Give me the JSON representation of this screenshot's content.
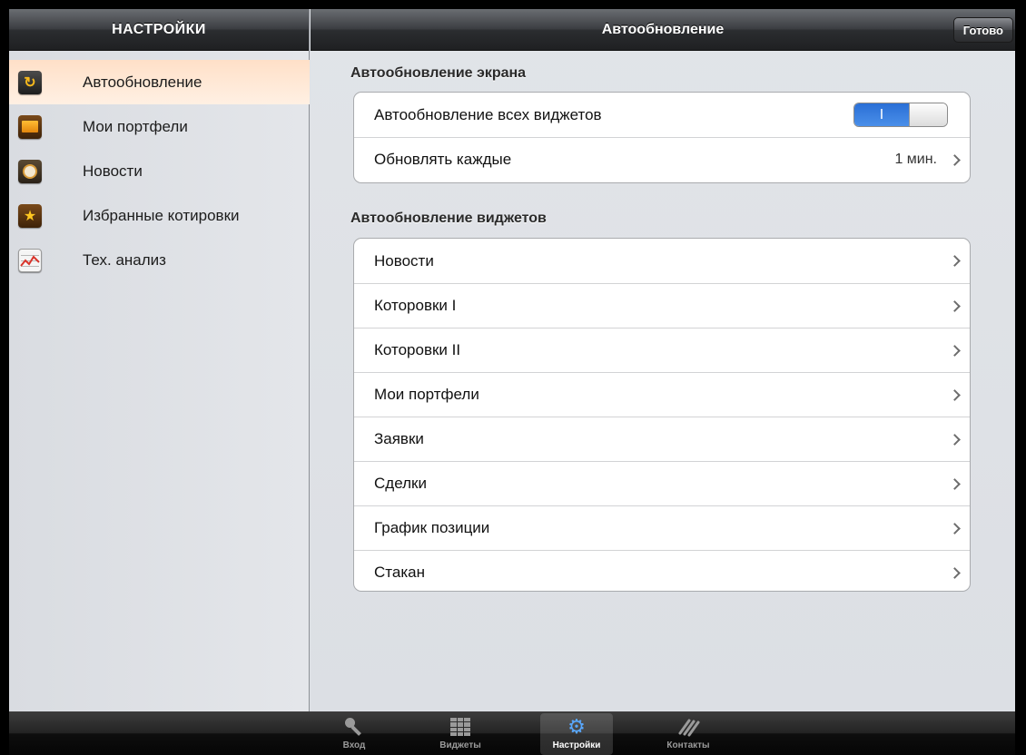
{
  "sidebar": {
    "title": "НАСТРОЙКИ",
    "items": [
      {
        "label": "Автообновление",
        "icon": "refresh-icon",
        "selected": true
      },
      {
        "label": "Мои портфели",
        "icon": "envelope-icon",
        "selected": false
      },
      {
        "label": "Новости",
        "icon": "clock-icon",
        "selected": false
      },
      {
        "label": "Избранные котировки",
        "icon": "star-icon",
        "selected": false
      },
      {
        "label": "Тех. анализ",
        "icon": "chart-icon",
        "selected": false
      }
    ]
  },
  "header": {
    "title": "Автообновление",
    "done_label": "Готово"
  },
  "screen_section": {
    "title": "Автообновление экрана",
    "toggle_row": {
      "label": "Автообновление всех виджетов",
      "toggle_on_text": "I",
      "toggle_state": "on"
    },
    "interval_row": {
      "label": "Обновлять каждые",
      "value": "1 мин."
    }
  },
  "widgets_section": {
    "title": "Автообновление виджетов",
    "rows": [
      {
        "label": "Новости"
      },
      {
        "label": "Которовки I"
      },
      {
        "label": "Которовки II"
      },
      {
        "label": "Мои портфели"
      },
      {
        "label": "Заявки"
      },
      {
        "label": "Сделки"
      },
      {
        "label": "График позиции"
      },
      {
        "label": "Стакан"
      }
    ]
  },
  "tabbar": {
    "tabs": [
      {
        "label": "Вход",
        "icon": "key-icon",
        "active": false
      },
      {
        "label": "Виджеты",
        "icon": "grid-icon",
        "active": false
      },
      {
        "label": "Настройки",
        "icon": "gears-icon",
        "active": true
      },
      {
        "label": "Контакты",
        "icon": "waves-icon",
        "active": false
      }
    ]
  },
  "colors": {
    "accent_blue": "#2a6fd6",
    "selected_row": "#ffe6d2",
    "bar_dark": "#2b2d30"
  }
}
